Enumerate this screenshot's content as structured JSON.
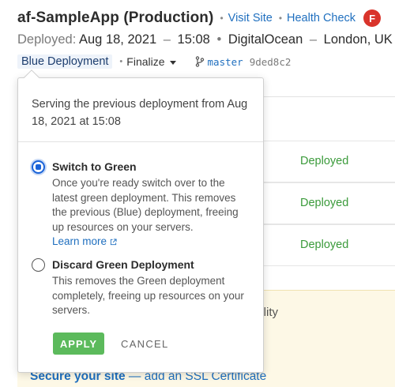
{
  "header": {
    "app_title": "af-SampleApp  (Production)",
    "visit_site": "Visit Site",
    "health_check": "Health Check",
    "avatar_initial": "F",
    "deployed_label": "Deployed:",
    "deployed_date": "Aug 18, 2021",
    "deployed_time": "15:08",
    "provider": "DigitalOcean",
    "region": "London, UK",
    "deployment_tag": "Blue Deployment",
    "finalize": "Finalize",
    "branch": "master",
    "commit": "9ded8c2"
  },
  "rows": [
    {
      "status": "Deployed"
    },
    {
      "status": "Deployed"
    },
    {
      "status": "Deployed"
    }
  ],
  "notice": {
    "partial_text": "bility",
    "ssl_bold": "Secure your site",
    "ssl_rest": " — add an SSL Certificate"
  },
  "popover": {
    "intro": "Serving the previous deployment from Aug 18, 2021 at 15:08",
    "options": [
      {
        "title": "Switch to Green",
        "description": "Once you're ready switch over to the latest green deployment. This removes the previous (Blue) deployment, freeing up resources on your servers.",
        "learn_more": "Learn more",
        "selected": true
      },
      {
        "title": "Discard Green Deployment",
        "description": "This removes the Green deployment completely, freeing up resources on your servers.",
        "selected": false
      }
    ],
    "apply": "APPLY",
    "cancel": "CANCEL"
  },
  "colors": {
    "link": "#1f6fbf",
    "avatar": "#d9342b",
    "status_green": "#3a9a3a",
    "apply_button": "#5cba5c",
    "radio_selected": "#1a63d8",
    "notice_bg": "#fdf8e6"
  }
}
